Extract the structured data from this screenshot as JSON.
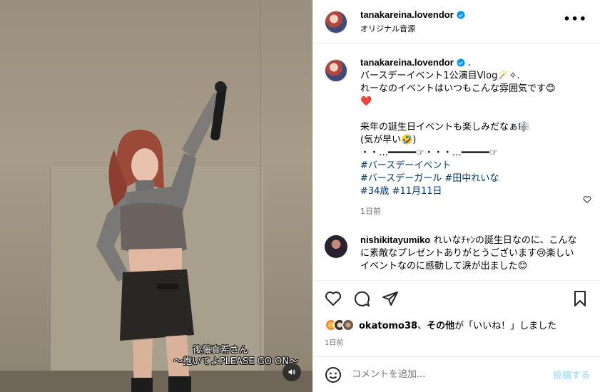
{
  "post_header": {
    "username": "tanakareina.lovendor",
    "audio": "オリジナル音源"
  },
  "caption": {
    "username": "tanakareina.lovendor",
    "suffix": ".",
    "lines": [
      "バースデーイベント1公演目Vlog🪄✧.",
      "れーなのイベントはいつもこんな雰囲気です😊",
      "❤️",
      "",
      "来年の誕生日イベントも楽しみだなぁ🎼",
      "(気が早い🤣)",
      "・・…━━━━━☞・・・…━━━━━☞"
    ],
    "hashtags": [
      "#バースデーイベント",
      "#バースデーガール #田中れいな",
      "#34歳 #11月11日"
    ],
    "time": "1日前"
  },
  "comment": {
    "username": "nishikitayumiko",
    "text": "れいなﾁｬﾝの誕生日なのに、こんなに素敵なプレゼントありがとうございます😢楽しいイベントなのに感動して涙が出ました😊"
  },
  "likes": {
    "user": "okatomo38",
    "connector": "、",
    "others": "その他",
    "suffix": "が「いいね！」しました"
  },
  "post_time": "1日前",
  "comment_box": {
    "placeholder": "コメントを追加...",
    "post_label": "投稿する"
  },
  "video_caption": {
    "line1": "後藤真希さん",
    "line2": "〜抱いてよPLEASE GO ON〜"
  },
  "colors": {
    "link": "#00376b",
    "verified": "#0095f6",
    "post_disabled": "#b2dffc",
    "meta": "#737373"
  },
  "icons": [
    "verified-icon",
    "more-icon",
    "heart-icon",
    "comment-icon",
    "share-icon",
    "bookmark-icon",
    "emoji-icon",
    "mute-icon"
  ]
}
